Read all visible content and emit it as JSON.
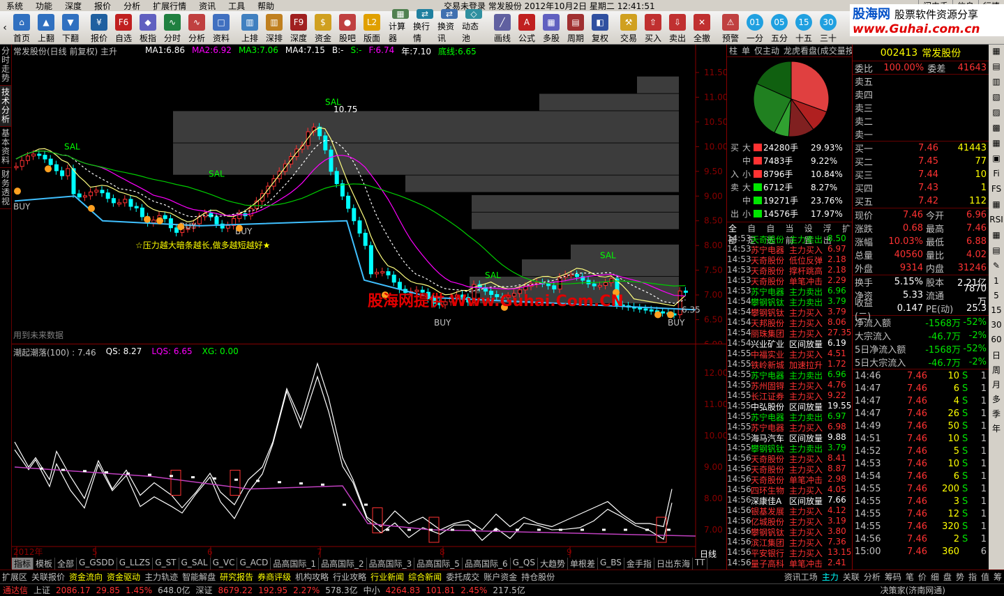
{
  "menu": {
    "items": [
      "系统",
      "功能",
      "深度",
      "报价",
      "分析",
      "扩展行情",
      "资讯",
      "工具",
      "帮助"
    ],
    "status": "交易未登录   常发股份  2012年10月2日  星期二  12:41:51",
    "right": [
      "闪电手",
      "信息",
      "行情"
    ]
  },
  "brand": {
    "logo": "股海网",
    "slogan": "股票软件资源分享",
    "url": "www.Guhai.com.cn"
  },
  "toolbar": [
    "首页",
    "上翻",
    "下翻",
    "报价",
    "自选",
    "板指",
    "分时",
    "分析",
    "资料",
    "上排",
    "深排",
    "深度",
    "资金",
    "股吧",
    "版面",
    "计算器",
    "换行情",
    "换资讯",
    "动态池",
    "画线",
    "公式",
    "多股",
    "周期",
    "复权",
    "交易",
    "买入",
    "卖出",
    "全撤",
    "预警",
    "一分",
    "五分",
    "十五",
    "三十"
  ],
  "lefttabs": [
    "分时走势",
    "技术分析",
    "基本资料",
    "财务透视"
  ],
  "chart": {
    "title": "常发股份(日线 前复权) 主升",
    "ma": [
      {
        "k": "MA1:",
        "v": "6.86",
        "c": "#fff"
      },
      {
        "k": "MA2:",
        "v": "6.92",
        "c": "#ff00ff"
      },
      {
        "k": "MA3:",
        "v": "7.06",
        "c": "#00ff00"
      },
      {
        "k": "MA4:",
        "v": "7.15",
        "c": "#fff"
      },
      {
        "k": "B:",
        "v": "-",
        "c": "#fff"
      },
      {
        "k": "S:",
        "v": "-",
        "c": "#00ff00"
      },
      {
        "k": "F:",
        "v": "6.74",
        "c": "#ff00ff"
      },
      {
        "k": "年:",
        "v": "7.10",
        "c": "#fff"
      },
      {
        "k": "底线:",
        "v": "6.65",
        "c": "#00ff00"
      }
    ],
    "yaxis": [
      "11.50",
      "11.00",
      "10.50",
      "10.00",
      "9.50",
      "9.00",
      "8.50",
      "8.00",
      "7.50",
      "7.00",
      "6.50",
      "6.00"
    ],
    "ylim": [
      6.0,
      11.5
    ],
    "note": "☆压力越大暗条越长,做多越短越好★",
    "peak": "10.75",
    "watermark": "股海网提供 Www.Guhai.Com.CN",
    "future": "用到未来数据",
    "sal": "SAL",
    "buy": "BUY",
    "lastp": "6.35"
  },
  "sub": {
    "title": "潮起潮落(100) : 7.46",
    "qs": "QS: 8.27",
    "lqs": "LQS: 6.65",
    "xg": "XG: 0.00",
    "yaxis": [
      "12.00",
      "11.00",
      "10.00",
      "9.00",
      "8.00",
      "7.00"
    ],
    "xaxis": [
      "2012年",
      "5",
      "6",
      "7",
      "8",
      "9"
    ],
    "period": "日线"
  },
  "charttabs": [
    "指标",
    "模板",
    "全部",
    "G_GSDD",
    "G_LLZS",
    "G_ST",
    "G_SAL",
    "G_VC",
    "G_ACD",
    "品高国际_1",
    "品高国际_2",
    "品高国际_3",
    "品高国际_5",
    "品高国际_6",
    "G_QS",
    "大趋势",
    "单根差",
    "G_BS",
    "金手指",
    "日出东海",
    "TT"
  ],
  "bottomtabs": [
    "扩展区",
    "关联报价",
    "资金流向",
    "资金驱动",
    "主力轨迹",
    "智能解盘",
    "研究报告",
    "券商评级",
    "机构攻略",
    "行业攻略",
    "行业新闻",
    "综合新闻",
    "委托成交",
    "账户资金",
    "持仓股份",
    "资讯工场",
    "主力",
    "关联",
    "分析",
    "筹码",
    "笔",
    "价",
    "细",
    "盘",
    "势",
    "指",
    "值",
    "筹"
  ],
  "status": [
    {
      "k": "通达信",
      "c": "#ff3232"
    },
    {
      "k": "上证",
      "c": "#c0c0c0"
    },
    {
      "k": "2086.17",
      "c": "#ff3232"
    },
    {
      "k": "29.85",
      "c": "#ff3232"
    },
    {
      "k": "1.45%",
      "c": "#ff3232"
    },
    {
      "k": "648.0亿",
      "c": "#c0c0c0"
    },
    {
      "k": "深证",
      "c": "#c0c0c0"
    },
    {
      "k": "8679.22",
      "c": "#ff3232"
    },
    {
      "k": "192.95",
      "c": "#ff3232"
    },
    {
      "k": "2.27%",
      "c": "#ff3232"
    },
    {
      "k": "578.3亿",
      "c": "#c0c0c0"
    },
    {
      "k": "中小",
      "c": "#c0c0c0"
    },
    {
      "k": "4264.83",
      "c": "#ff3232"
    },
    {
      "k": "101.81",
      "c": "#ff3232"
    },
    {
      "k": "2.45%",
      "c": "#ff3232"
    },
    {
      "k": "217.5亿",
      "c": "#c0c0c0"
    },
    {
      "k": "决策家(济南网通)",
      "c": "#c0c0c0"
    }
  ],
  "mid": {
    "tabs": [
      "柱",
      "单",
      "仅主动",
      "龙虎看盘(成交量按"
    ],
    "pie": [
      29.93,
      9.22,
      10.84,
      6.2,
      23.76,
      17.97
    ],
    "flows": [
      {
        "g": "买",
        "s": "大",
        "v": "24280手",
        "p": "29.93%",
        "c": "#ff3232"
      },
      {
        "g": "",
        "s": "中",
        "v": "7483手",
        "p": "9.22%",
        "c": "#ff3232"
      },
      {
        "g": "入",
        "s": "小",
        "v": "8796手",
        "p": "10.84%",
        "c": "#ff3232"
      },
      {
        "g": "卖",
        "s": "大",
        "v": "6712手",
        "p": "8.27%",
        "c": "#00e600"
      },
      {
        "g": "",
        "s": "中",
        "v": "19271手",
        "p": "23.76%",
        "c": "#00e600"
      },
      {
        "g": "出",
        "s": "小",
        "v": "14576手",
        "p": "17.97%",
        "c": "#00e600"
      }
    ],
    "listtabs": [
      "全部",
      "自定",
      "自选",
      "当前",
      "设置",
      "浮出",
      "扩"
    ],
    "rows": [
      [
        "14:53",
        "天奇股份",
        "主力卖出",
        "8.50"
      ],
      [
        "14:53",
        "苏宁电器",
        "主力买入",
        "6.97"
      ],
      [
        "14:53",
        "天奇股份",
        "低位反弹",
        "2.18"
      ],
      [
        "14:53",
        "天奇股份",
        "撑杆跳高",
        "2.18"
      ],
      [
        "14:53",
        "天奇股份",
        "单笔冲击",
        "2.29"
      ],
      [
        "14:53",
        "苏宁电器",
        "主力卖出",
        "6.96"
      ],
      [
        "14:54",
        "攀钢钒钛",
        "主力卖出",
        "3.79"
      ],
      [
        "14:54",
        "攀钢钒钛",
        "主力买入",
        "3.79"
      ],
      [
        "14:54",
        "天邦股份",
        "主力买入",
        "8.06"
      ],
      [
        "14:54",
        "丽珠集团",
        "主力买入",
        "27.35"
      ],
      [
        "14:54",
        "兴业矿业",
        "区间放量",
        "6.19"
      ],
      [
        "14:55",
        "中福实业",
        "主力买入",
        "4.51"
      ],
      [
        "14:55",
        "铁岭新城",
        "加速拉升",
        "1.72"
      ],
      [
        "14:55",
        "苏宁电器",
        "主力卖出",
        "6.96"
      ],
      [
        "14:55",
        "苏州固锝",
        "主力买入",
        "4.76"
      ],
      [
        "14:55",
        "长江证券",
        "主力买入",
        "9.22"
      ],
      [
        "14:55",
        "中弘股份",
        "区间放量",
        "19.55"
      ],
      [
        "14:55",
        "苏宁电器",
        "主力卖出",
        "6.97"
      ],
      [
        "14:55",
        "苏宁电器",
        "主力买入",
        "6.98"
      ],
      [
        "14:55",
        "海马汽车",
        "区间放量",
        "9.88"
      ],
      [
        "14:55",
        "攀钢钒钛",
        "主力卖出",
        "3.79"
      ],
      [
        "14:56",
        "天奇股份",
        "主力买入",
        "8.41"
      ],
      [
        "14:56",
        "天奇股份",
        "主力买入",
        "8.87"
      ],
      [
        "14:56",
        "天奇股份",
        "单笔冲击",
        "2.98"
      ],
      [
        "14:56",
        "四环生物",
        "主力买入",
        "4.05"
      ],
      [
        "14:56",
        "深康佳A",
        "区间放量",
        "7.66"
      ],
      [
        "14:56",
        "银基发展",
        "主力买入",
        "4.12"
      ],
      [
        "14:56",
        "亿城股份",
        "主力买入",
        "3.19"
      ],
      [
        "14:56",
        "攀钢钒钛",
        "主力买入",
        "3.80"
      ],
      [
        "14:56",
        "滨江集团",
        "主力买入",
        "7.36"
      ],
      [
        "14:56",
        "平安银行",
        "主力买入",
        "13.15"
      ],
      [
        "14:56",
        "量子高科",
        "单笔冲击",
        "2.41"
      ]
    ]
  },
  "quote": {
    "code": "002413",
    "name": "常发股份",
    "wb": {
      "k": "委比",
      "v": "100.00%",
      "k2": "委差",
      "v2": "41643"
    },
    "sell": [
      "卖五",
      "卖四",
      "卖三",
      "卖二",
      "卖一"
    ],
    "buy": [
      [
        "买一",
        "7.46",
        "41443"
      ],
      [
        "买二",
        "7.45",
        "77"
      ],
      [
        "买三",
        "7.44",
        "10"
      ],
      [
        "买四",
        "7.43",
        "1"
      ],
      [
        "买五",
        "7.42",
        "112"
      ]
    ],
    "stats": [
      [
        "现价",
        "7.46",
        "今开",
        "6.96"
      ],
      [
        "涨跌",
        "0.68",
        "最高",
        "7.46"
      ],
      [
        "涨幅",
        "10.03%",
        "最低",
        "6.88"
      ],
      [
        "总量",
        "40560",
        "量比",
        "4.02"
      ],
      [
        "外盘",
        "9314",
        "内盘",
        "31246"
      ]
    ],
    "stats2": [
      [
        "换手",
        "5.15%",
        "股本",
        "2.21亿"
      ],
      [
        "净资",
        "5.33",
        "流通",
        "7870万"
      ],
      [
        "收益(二)",
        "0.147",
        "PE(动)",
        "25.3"
      ]
    ],
    "money": [
      [
        "净流入额",
        "-1568万",
        "-52%"
      ],
      [
        "大宗流入",
        "-46.7万",
        "-2%"
      ],
      [
        "5日净流入额",
        "-1568万",
        "-52%"
      ],
      [
        "5日大宗流入",
        "-46.7万",
        "-2%"
      ]
    ],
    "ticks": [
      [
        "14:46",
        "7.46",
        "10",
        "S",
        "1"
      ],
      [
        "14:47",
        "7.46",
        "6",
        "S",
        "1"
      ],
      [
        "14:47",
        "7.46",
        "4",
        "S",
        "1"
      ],
      [
        "14:47",
        "7.46",
        "26",
        "S",
        "1"
      ],
      [
        "14:49",
        "7.46",
        "50",
        "S",
        "1"
      ],
      [
        "14:51",
        "7.46",
        "10",
        "S",
        "1"
      ],
      [
        "14:52",
        "7.46",
        "5",
        "S",
        "1"
      ],
      [
        "14:53",
        "7.46",
        "10",
        "S",
        "1"
      ],
      [
        "14:54",
        "7.46",
        "6",
        "S",
        "1"
      ],
      [
        "14:55",
        "7.46",
        "200",
        "S",
        "1"
      ],
      [
        "14:55",
        "7.46",
        "3",
        "S",
        "1"
      ],
      [
        "14:55",
        "7.46",
        "12",
        "S",
        "1"
      ],
      [
        "14:55",
        "7.46",
        "320",
        "S",
        "1"
      ],
      [
        "14:56",
        "7.46",
        "2",
        "S",
        "1"
      ],
      [
        "15:00",
        "7.46",
        "360",
        "",
        "6"
      ]
    ]
  },
  "farright": [
    "1",
    "5",
    "15",
    "30",
    "60",
    "日",
    "周",
    "月",
    "多",
    "季",
    "年"
  ]
}
